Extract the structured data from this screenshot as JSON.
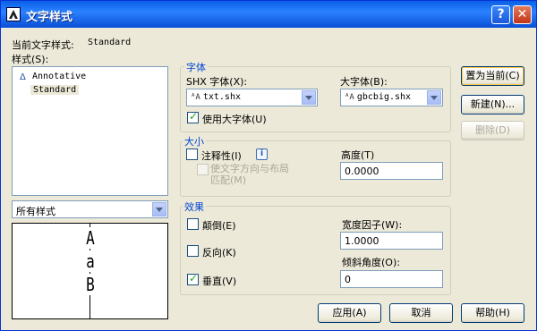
{
  "window": {
    "title": "文字样式",
    "help_glyph": "?",
    "close_glyph": "✕"
  },
  "current_style": {
    "label": "当前文字样式:",
    "value": "Standard"
  },
  "styles": {
    "label": "样式(S):",
    "items": [
      "Annotative",
      "Standard"
    ],
    "selected": "Standard"
  },
  "filter": {
    "value": "所有样式"
  },
  "preview": {
    "chars": [
      "A",
      "a",
      "B"
    ]
  },
  "font_group": {
    "title": "字体",
    "shx_label": "SHX 字体(X):",
    "shx_value": "txt.shx",
    "big_label": "大字体(B):",
    "big_value": "gbcbig.shx",
    "use_big_font": {
      "label": "使用大字体(U)",
      "checked": true
    }
  },
  "size_group": {
    "title": "大小",
    "annotative": {
      "label": "注释性(I)",
      "checked": false
    },
    "info_glyph": "i",
    "match_layout": {
      "label_line1": "使文字方向与布局",
      "label_line2": "匹配(M)",
      "checked": false,
      "enabled": false
    },
    "height_label": "高度(T)",
    "height_value": "0.0000"
  },
  "effects_group": {
    "title": "效果",
    "upside_down": {
      "label": "颠倒(E)",
      "checked": false
    },
    "backwards": {
      "label": "反向(K)",
      "checked": false
    },
    "vertical": {
      "label": "垂直(V)",
      "checked": true
    },
    "width_factor_label": "宽度因子(W):",
    "width_factor_value": "1.0000",
    "oblique_label": "倾斜角度(O):",
    "oblique_value": "0"
  },
  "side_buttons": {
    "set_current": "置为当前(C)",
    "new": "新建(N)...",
    "delete": "删除(D)"
  },
  "bottom_buttons": {
    "apply": "应用(A)",
    "cancel": "取消",
    "help": "帮助(H)"
  }
}
